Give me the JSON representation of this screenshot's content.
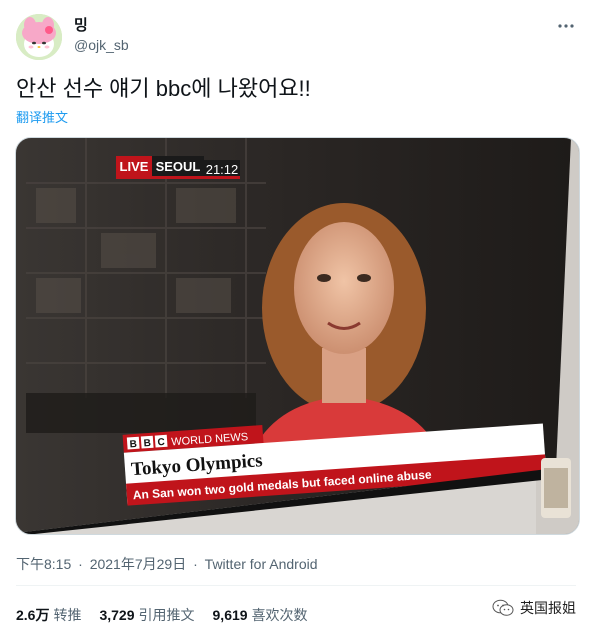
{
  "user": {
    "display_name": "밍",
    "handle": "@ojk_sb",
    "avatar_icon": "cartoon-bunny-avatar"
  },
  "tweet": {
    "text": "안산 선수 얘기 bbc에 나왔어요!!",
    "translate_label": "翻译推文"
  },
  "media": {
    "live_label": "LIVE",
    "location": "SEOUL",
    "time": "21:12",
    "channel": "WORLD NEWS",
    "headline": "Tokyo Olympics",
    "subheadline": "An San won two gold medals but faced online abuse",
    "bbc_letters": [
      "B",
      "B",
      "C"
    ]
  },
  "meta": {
    "time": "下午8:15",
    "date": "2021年7月29日",
    "source": "Twitter for Android"
  },
  "stats": {
    "retweets_count": "2.6万",
    "retweets_label": "转推",
    "quotes_count": "3,729",
    "quotes_label": "引用推文",
    "likes_count": "9,619",
    "likes_label": "喜欢次数"
  },
  "watermark": {
    "text": "英国报姐",
    "icon": "wechat-icon"
  },
  "colors": {
    "bbc_red": "#c0141b",
    "link_blue": "#1d9bf0",
    "muted": "#536471"
  }
}
